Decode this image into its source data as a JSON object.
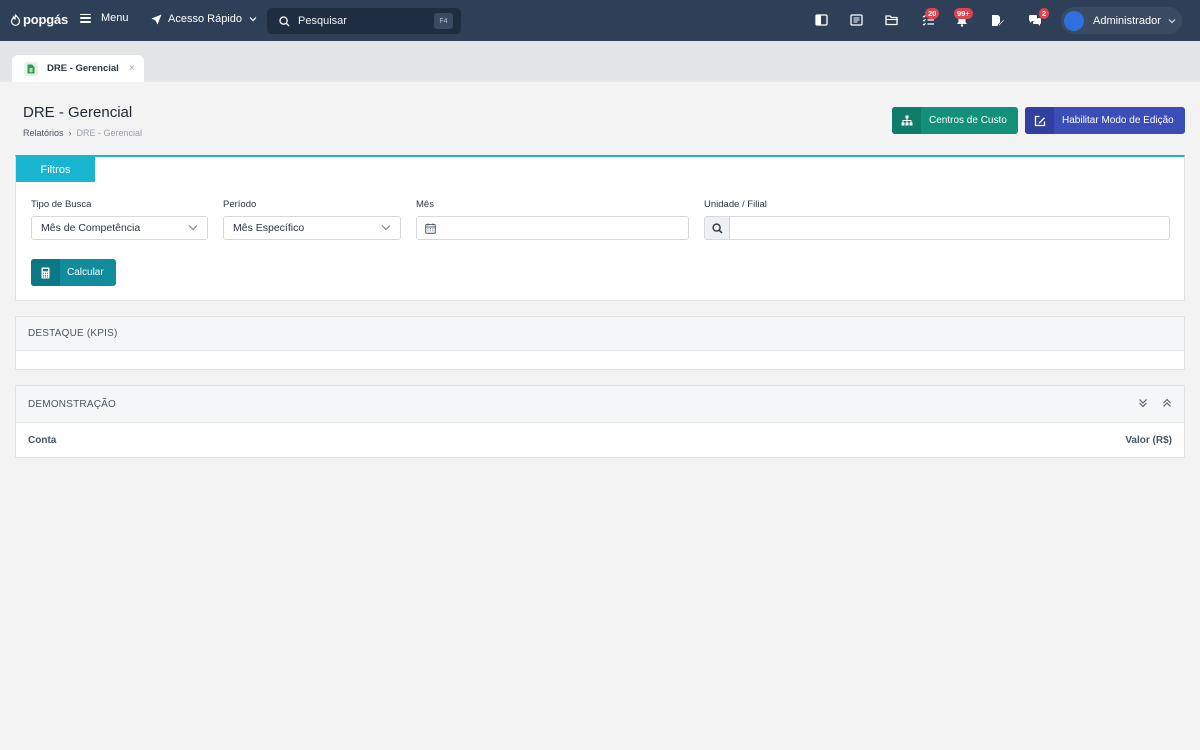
{
  "topbar": {
    "logo": "popgás",
    "menu_label": "Menu",
    "quick_access_label": "Acesso Rápido",
    "search_placeholder": "Pesquisar",
    "search_shortcut": "F4",
    "icons": [
      "panel-icon",
      "news-icon",
      "folder-icon",
      "tasks-icon",
      "bell-icon",
      "edit-doc-icon",
      "chat-icon"
    ],
    "badges": {
      "tasks": "20",
      "notifications": "99+",
      "messages": "2"
    },
    "user_name": "Administrador"
  },
  "tabs": [
    {
      "label": "DRE - Gerencial",
      "close": "×"
    }
  ],
  "page": {
    "title": "DRE - Gerencial",
    "breadcrumb": {
      "parent": "Relatórios",
      "separator": "›",
      "current": "DRE - Gerencial"
    },
    "actions": {
      "cost_centers": "Centros de Custo",
      "edit_mode": "Habilitar Modo de Edição"
    }
  },
  "filters": {
    "tab_label": "Filtros",
    "fields": {
      "search_type": {
        "label": "Tipo de Busca",
        "value": "Mês de Competência"
      },
      "period": {
        "label": "Período",
        "value": "Mês Específico"
      },
      "month": {
        "label": "Mês",
        "value": ""
      },
      "unit": {
        "label": "Unidade / Filial",
        "value": ""
      }
    },
    "calculate_label": "Calcular"
  },
  "kpis": {
    "title": "DESTAQUE (KPIS)"
  },
  "statement": {
    "title": "DEMONSTRAÇÃO",
    "columns": {
      "account": "Conta",
      "value": "Valor (R$)"
    }
  },
  "colors": {
    "topbar": "#2e4057",
    "accent_cyan": "#19b4d0",
    "teal_button": "#12907a",
    "indigo_button": "#3d4db8",
    "badge_red": "#e0434d"
  }
}
